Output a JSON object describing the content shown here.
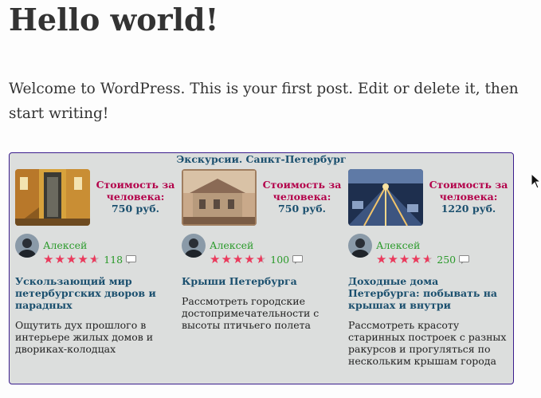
{
  "post": {
    "title": "Hello world!",
    "body": "Welcome to WordPress. This is your first post. Edit or delete it, then start writing!"
  },
  "widget": {
    "heading": "Экскурсии. Санкт-Петербург",
    "cards": [
      {
        "price_label": "Стоимость за человека:",
        "price_value": "750 руб.",
        "author": "Алексей",
        "rating_stars": 4.5,
        "reviews": "118",
        "title": "Ускользающий мир петербургских дворов и парадных",
        "description": "Ощутить дух прошлого в интерьере жилых домов и двориках-колодцах"
      },
      {
        "price_label": "Стоимость за человека:",
        "price_value": "750 руб.",
        "author": "Алексей",
        "rating_stars": 4.5,
        "reviews": "100",
        "title": "Крыши Петербурга",
        "description": "Рассмотреть городские достопримечательности с высоты птичьего полета"
      },
      {
        "price_label": "Стоимость за человека:",
        "price_value": "1220 руб.",
        "author": "Алексей",
        "rating_stars": 4.5,
        "reviews": "250",
        "title": "Доходные дома Петербурга: побывать на крышах и внутри",
        "description": "Рассмотреть красоту старинных построек с разных ракурсов и прогуляться по нескольким крышам города"
      }
    ]
  },
  "colors": {
    "price_label": "#b3004a",
    "link": "#1a4f6e",
    "author": "#2a9a2a",
    "star": "#ea3a5c",
    "widget_border": "#3a1c8c",
    "widget_bg": "#dcdedd"
  },
  "icons": {
    "comment": "comment-icon",
    "cursor": "mouse-pointer-icon"
  }
}
